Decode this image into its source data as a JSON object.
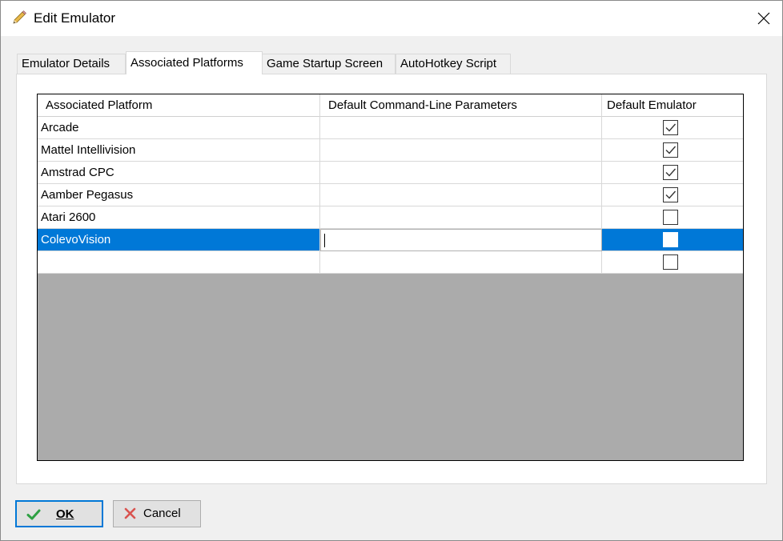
{
  "window": {
    "title": "Edit Emulator"
  },
  "tabs": [
    {
      "label": "Emulator Details",
      "active": false
    },
    {
      "label": "Associated Platforms",
      "active": true
    },
    {
      "label": "Game Startup Screen",
      "active": false
    },
    {
      "label": "AutoHotkey Script",
      "active": false
    }
  ],
  "grid": {
    "columns": [
      "Associated Platform",
      "Default Command-Line Parameters",
      "Default Emulator"
    ],
    "rows": [
      {
        "platform": "Arcade",
        "params": "",
        "default": true
      },
      {
        "platform": "Mattel Intellivision",
        "params": "",
        "default": true
      },
      {
        "platform": "Amstrad CPC",
        "params": "",
        "default": true
      },
      {
        "platform": "Aamber Pegasus",
        "params": "",
        "default": true
      },
      {
        "platform": "Atari 2600",
        "params": "",
        "default": false
      },
      {
        "platform": "ColevoVision",
        "params": "",
        "default": false,
        "selected": true
      },
      {
        "platform": "",
        "params": "",
        "default": false
      }
    ]
  },
  "buttons": {
    "ok_label": "OK",
    "cancel_label": "Cancel"
  },
  "colors": {
    "selection": "#0078d7",
    "ok_icon": "#2ea043",
    "cancel_icon": "#d9534f"
  }
}
